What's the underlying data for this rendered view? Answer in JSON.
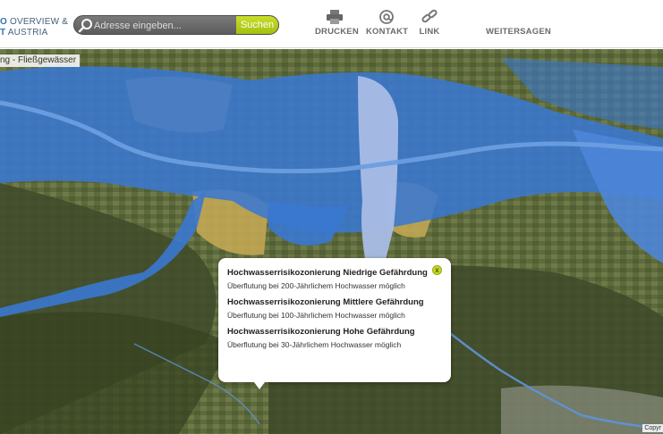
{
  "header": {
    "logo_line1_accent": "O",
    "logo_line1_rest": "OVERVIEW &",
    "logo_line2_accent": "T",
    "logo_line2_rest": " AUSTRIA",
    "search": {
      "placeholder": "Adresse eingeben...",
      "button_label": "Suchen"
    },
    "nav": [
      {
        "label": "DRUCKEN",
        "icon": "printer-icon"
      },
      {
        "label": "KONTAKT",
        "icon": "at-sign-icon"
      },
      {
        "label": "LINK",
        "icon": "chain-link-icon"
      },
      {
        "label": "WEITERSAGEN"
      }
    ]
  },
  "map": {
    "layer_label": "ng - Fließgewässer",
    "copyright": "Copyr",
    "colors": {
      "flood_blue": "#3a78d0",
      "flood_light": "#a9bde6",
      "flood_yellow": "#c8aa55",
      "terrain": "#4a5630"
    }
  },
  "popup": {
    "close_label": "x",
    "zones": [
      {
        "title": "Hochwasserrisikozonierung Niedrige Gefährdung",
        "desc": "Überflutung bei 200-Jährlichem Hochwasser möglich"
      },
      {
        "title": "Hochwasserrisikozonierung Mittlere Gefährdung",
        "desc": "Überflutung bei 100-Jährlichem Hochwasser möglich"
      },
      {
        "title": "Hochwasserrisikozonierung Hohe Gefährdung",
        "desc": "Überflutung bei 30-Jährlichem Hochwasser möglich"
      }
    ]
  }
}
